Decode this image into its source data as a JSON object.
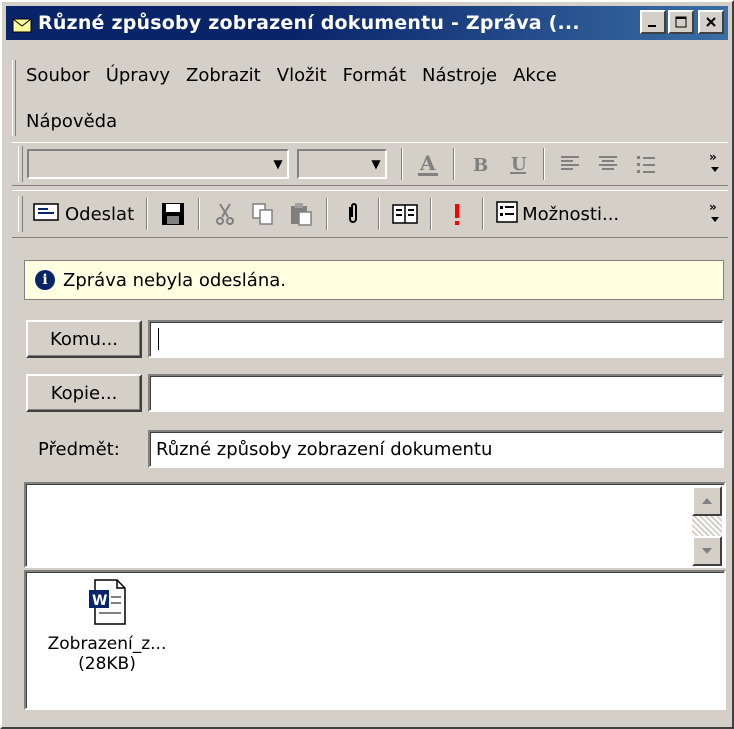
{
  "window": {
    "title": "Různé způsoby zobrazení dokumentu - Zpráva (...",
    "controls": [
      "minimize",
      "maximize",
      "close"
    ]
  },
  "menubar": {
    "items": [
      "Soubor",
      "Úpravy",
      "Zobrazit",
      "Vložit",
      "Formát",
      "Nástroje",
      "Akce",
      "Nápověda"
    ]
  },
  "format_toolbar": {
    "font_value": "",
    "size_value": "",
    "icons": [
      "font-color-icon",
      "bold-icon",
      "underline-icon",
      "align-left-icon",
      "align-center-icon",
      "bullets-icon",
      "more-chevron-icon"
    ]
  },
  "standard_toolbar": {
    "send_label": "Odeslat",
    "options_label": "Možnosti...",
    "icons": [
      "send-icon",
      "save-icon",
      "cut-icon",
      "copy-icon",
      "paste-icon",
      "attach-icon",
      "address-book-icon",
      "importance-icon",
      "options-icon",
      "more-chevron-icon"
    ]
  },
  "info": {
    "message": "Zpráva nebyla odeslána."
  },
  "fields": {
    "to_button": "Komu...",
    "to_value": "",
    "cc_button": "Kopie...",
    "cc_value": "",
    "subject_label": "Předmět:",
    "subject_value": "Různé způsoby zobrazení dokumentu"
  },
  "body": {
    "text": ""
  },
  "attachment": {
    "name": "Zobrazení_z...",
    "size": "(28KB)"
  },
  "colors": {
    "title_start": "#0a246a",
    "title_end": "#3a6ea5",
    "face": "#d4d0c8",
    "info_bg": "#ffffe1",
    "importance": "#ff0000"
  }
}
